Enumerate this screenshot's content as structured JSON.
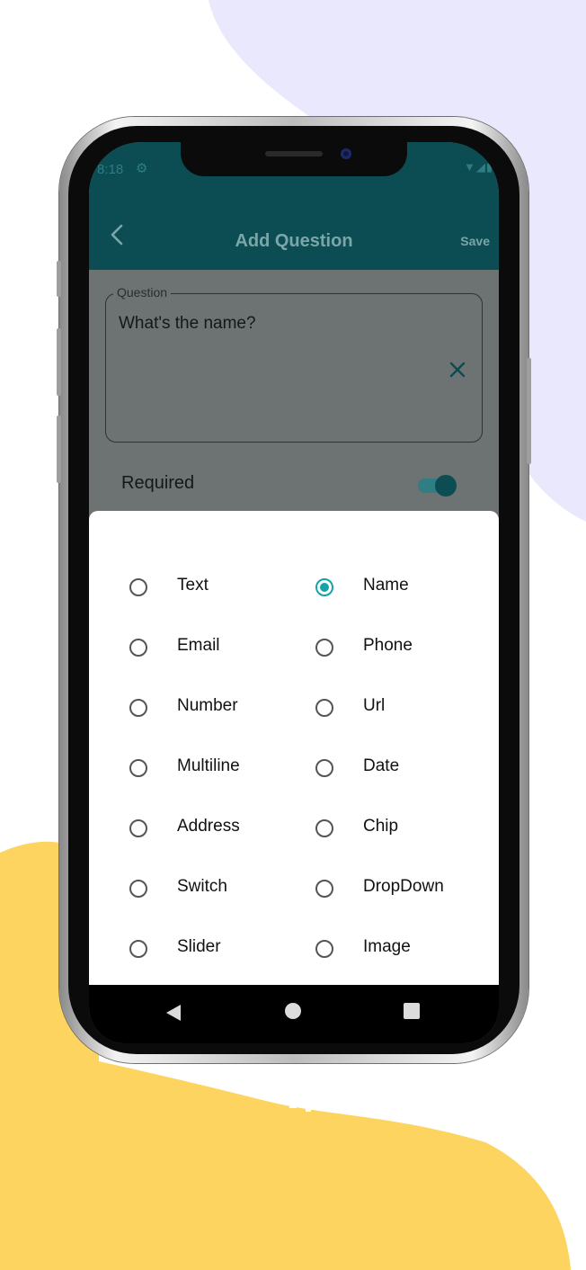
{
  "colors": {
    "background_lavender": "#e9e8fd",
    "background_yellow": "#fdd45f",
    "app_bar": "#0b4d52",
    "accent": "#14a3a8",
    "overlay_scrim": "#6d7273"
  },
  "status_bar": {
    "time": "8:18",
    "settings_icon": "gear-icon",
    "right_icons": "wifi-icon signal-icon battery-icon"
  },
  "app_bar": {
    "back_icon": "chevron-left-icon",
    "title": "Add Question",
    "save_label": "Save"
  },
  "question_field": {
    "label": "Question",
    "value": "What's the name?",
    "clear_icon": "close-icon"
  },
  "required": {
    "label": "Required",
    "enabled": true
  },
  "type_options": [
    {
      "label": "Text",
      "selected": false
    },
    {
      "label": "Name",
      "selected": true
    },
    {
      "label": "Email",
      "selected": false
    },
    {
      "label": "Phone",
      "selected": false
    },
    {
      "label": "Number",
      "selected": false
    },
    {
      "label": "Url",
      "selected": false
    },
    {
      "label": "Multiline",
      "selected": false
    },
    {
      "label": "Date",
      "selected": false
    },
    {
      "label": "Address",
      "selected": false
    },
    {
      "label": "Chip",
      "selected": false
    },
    {
      "label": "Switch",
      "selected": false
    },
    {
      "label": "DropDown",
      "selected": false
    },
    {
      "label": "Slider",
      "selected": false
    },
    {
      "label": "Image",
      "selected": false
    }
  ],
  "nav_bar": {
    "back_icon": "triangle-back-icon",
    "home_icon": "circle-home-icon",
    "recents_icon": "square-recents-icon"
  }
}
